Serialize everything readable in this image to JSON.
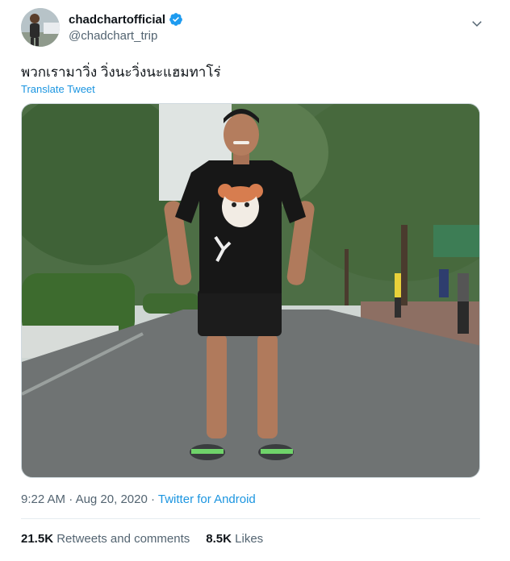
{
  "tweet": {
    "display_name": "chadchartofficial",
    "handle": "@chadchart_trip",
    "text": "พวกเรามาวิ่ง วิ่งนะวิ่งนะแฮมทาโร่",
    "translate_label": "Translate Tweet",
    "time": "9:22 AM",
    "date": "Aug 20, 2020",
    "source": "Twitter for Android",
    "separator": "·"
  },
  "stats": {
    "retweets_count": "21.5K",
    "retweets_label": "Retweets and comments",
    "likes_count": "8.5K",
    "likes_label": "Likes"
  },
  "colors": {
    "link": "#1b95e0",
    "verified": "#1d9bf0",
    "secondary_text": "#536471"
  },
  "icons": {
    "verified": "verified-badge-icon",
    "more": "chevron-down-icon"
  }
}
